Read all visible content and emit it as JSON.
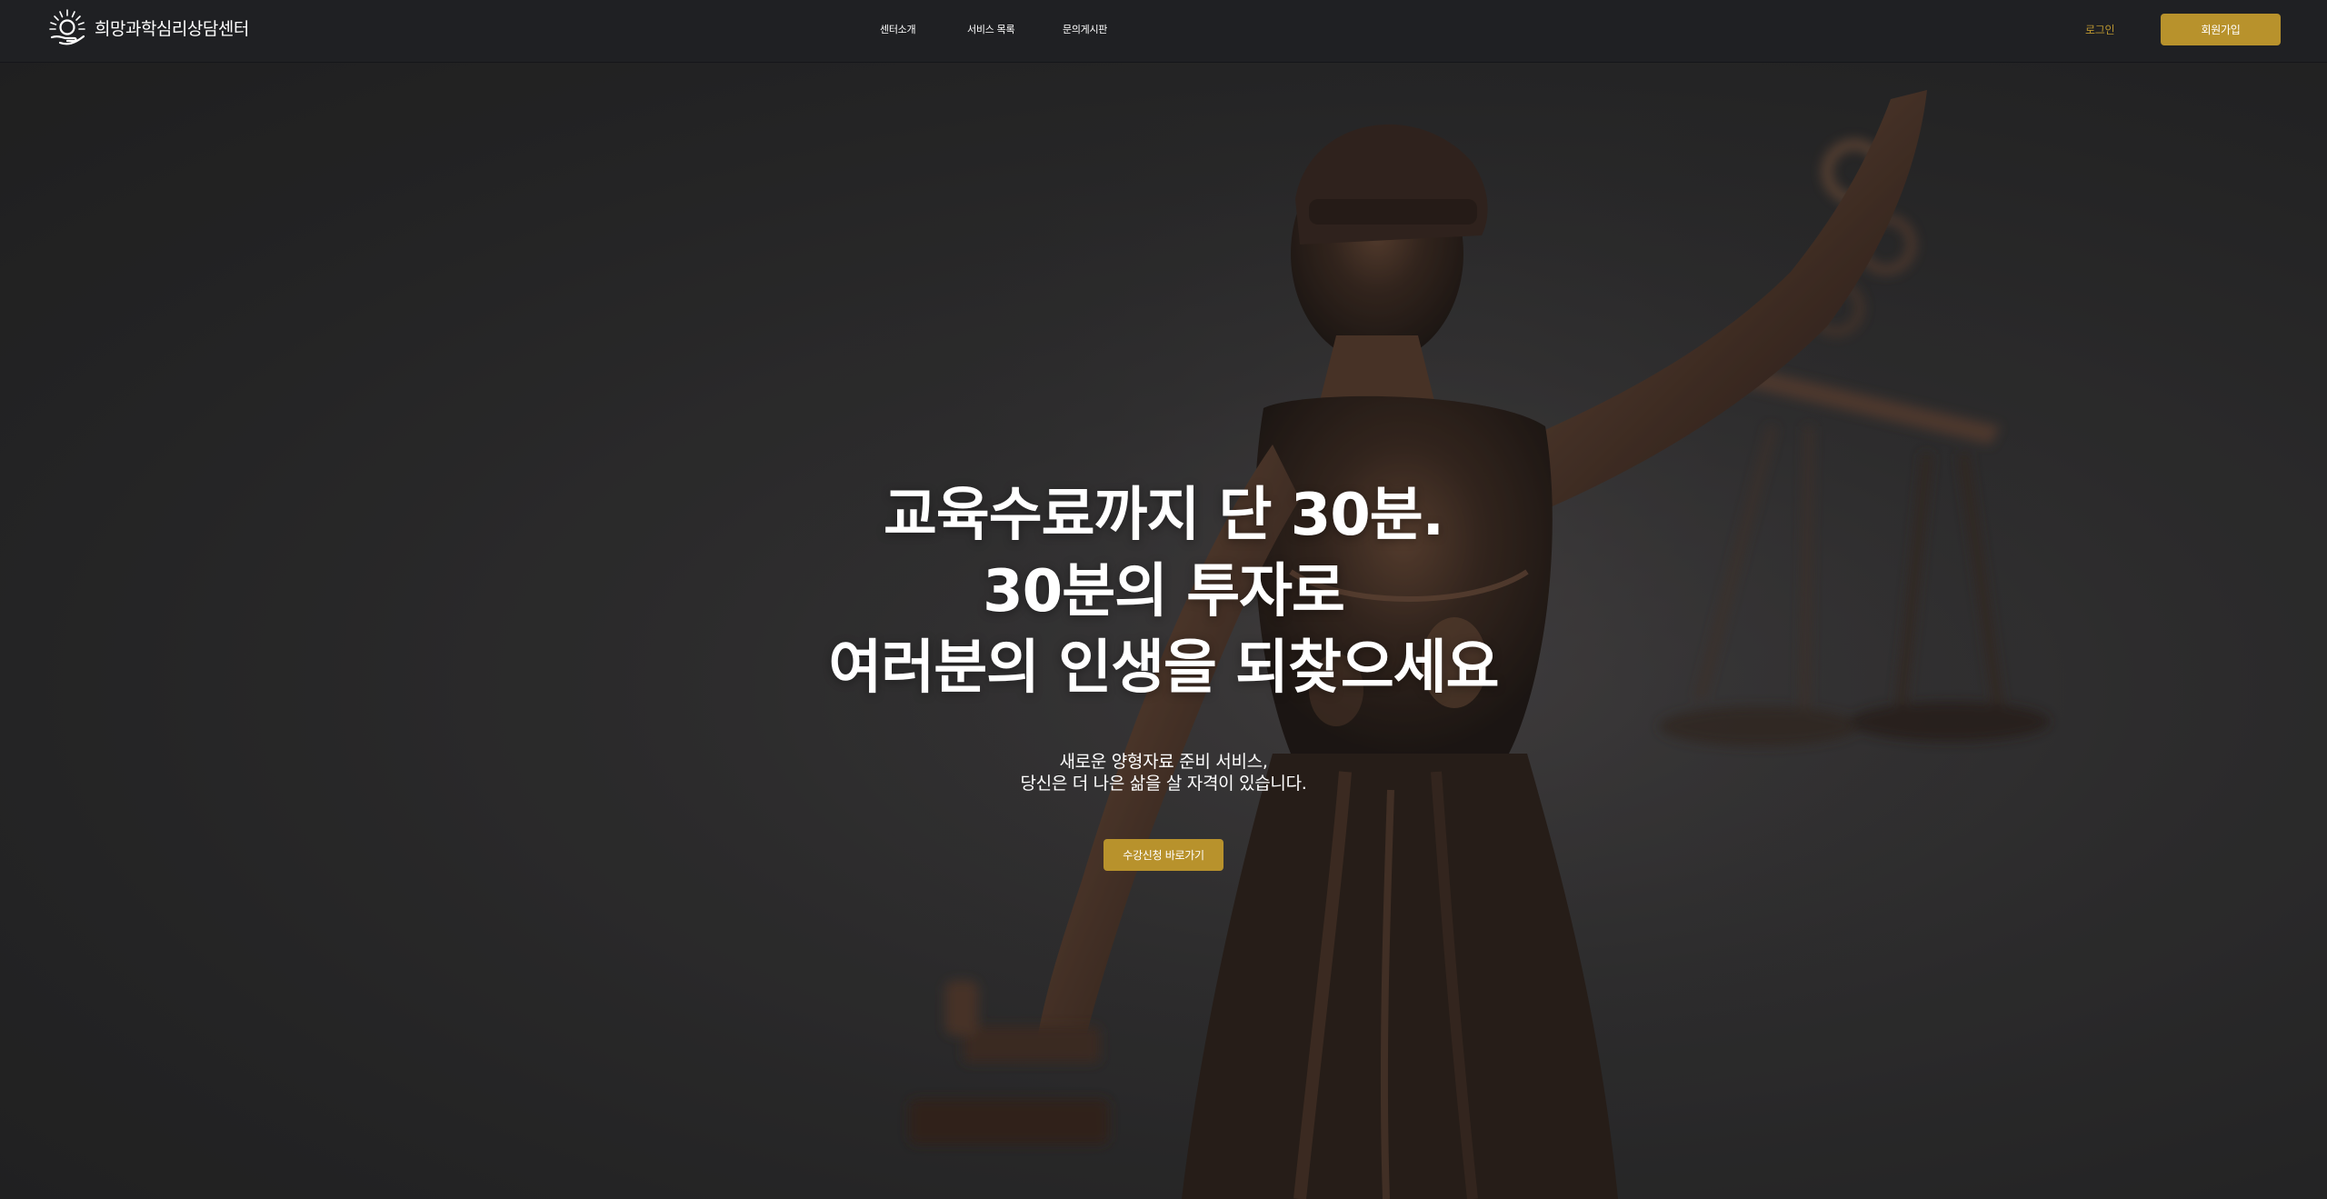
{
  "header": {
    "logo_text": "희망과학심리상담센터",
    "logo_icon": "sun-hand-icon",
    "nav": [
      {
        "label": "센터소개"
      },
      {
        "label": "서비스 목록"
      },
      {
        "label": "문의게시판"
      }
    ],
    "login_label": "로그인",
    "signup_label": "회원가입"
  },
  "hero": {
    "background_image": "lady-justice-statue",
    "headline": [
      "교육수료까지 단 30분.",
      "30분의 투자로",
      "여러분의 인생을 되찾으세요"
    ],
    "subtitle": [
      "새로운 양형자료 준비 서비스,",
      "당신은 더 나은 삶을 살 자격이 있습니다."
    ],
    "cta_label": "수강신청 바로가기"
  },
  "colors": {
    "header_bg": "#1f2023",
    "accent_gold": "#b8922c",
    "login_text": "#b99530",
    "hero_bg": "#2b2b2d",
    "text": "#ffffff"
  }
}
